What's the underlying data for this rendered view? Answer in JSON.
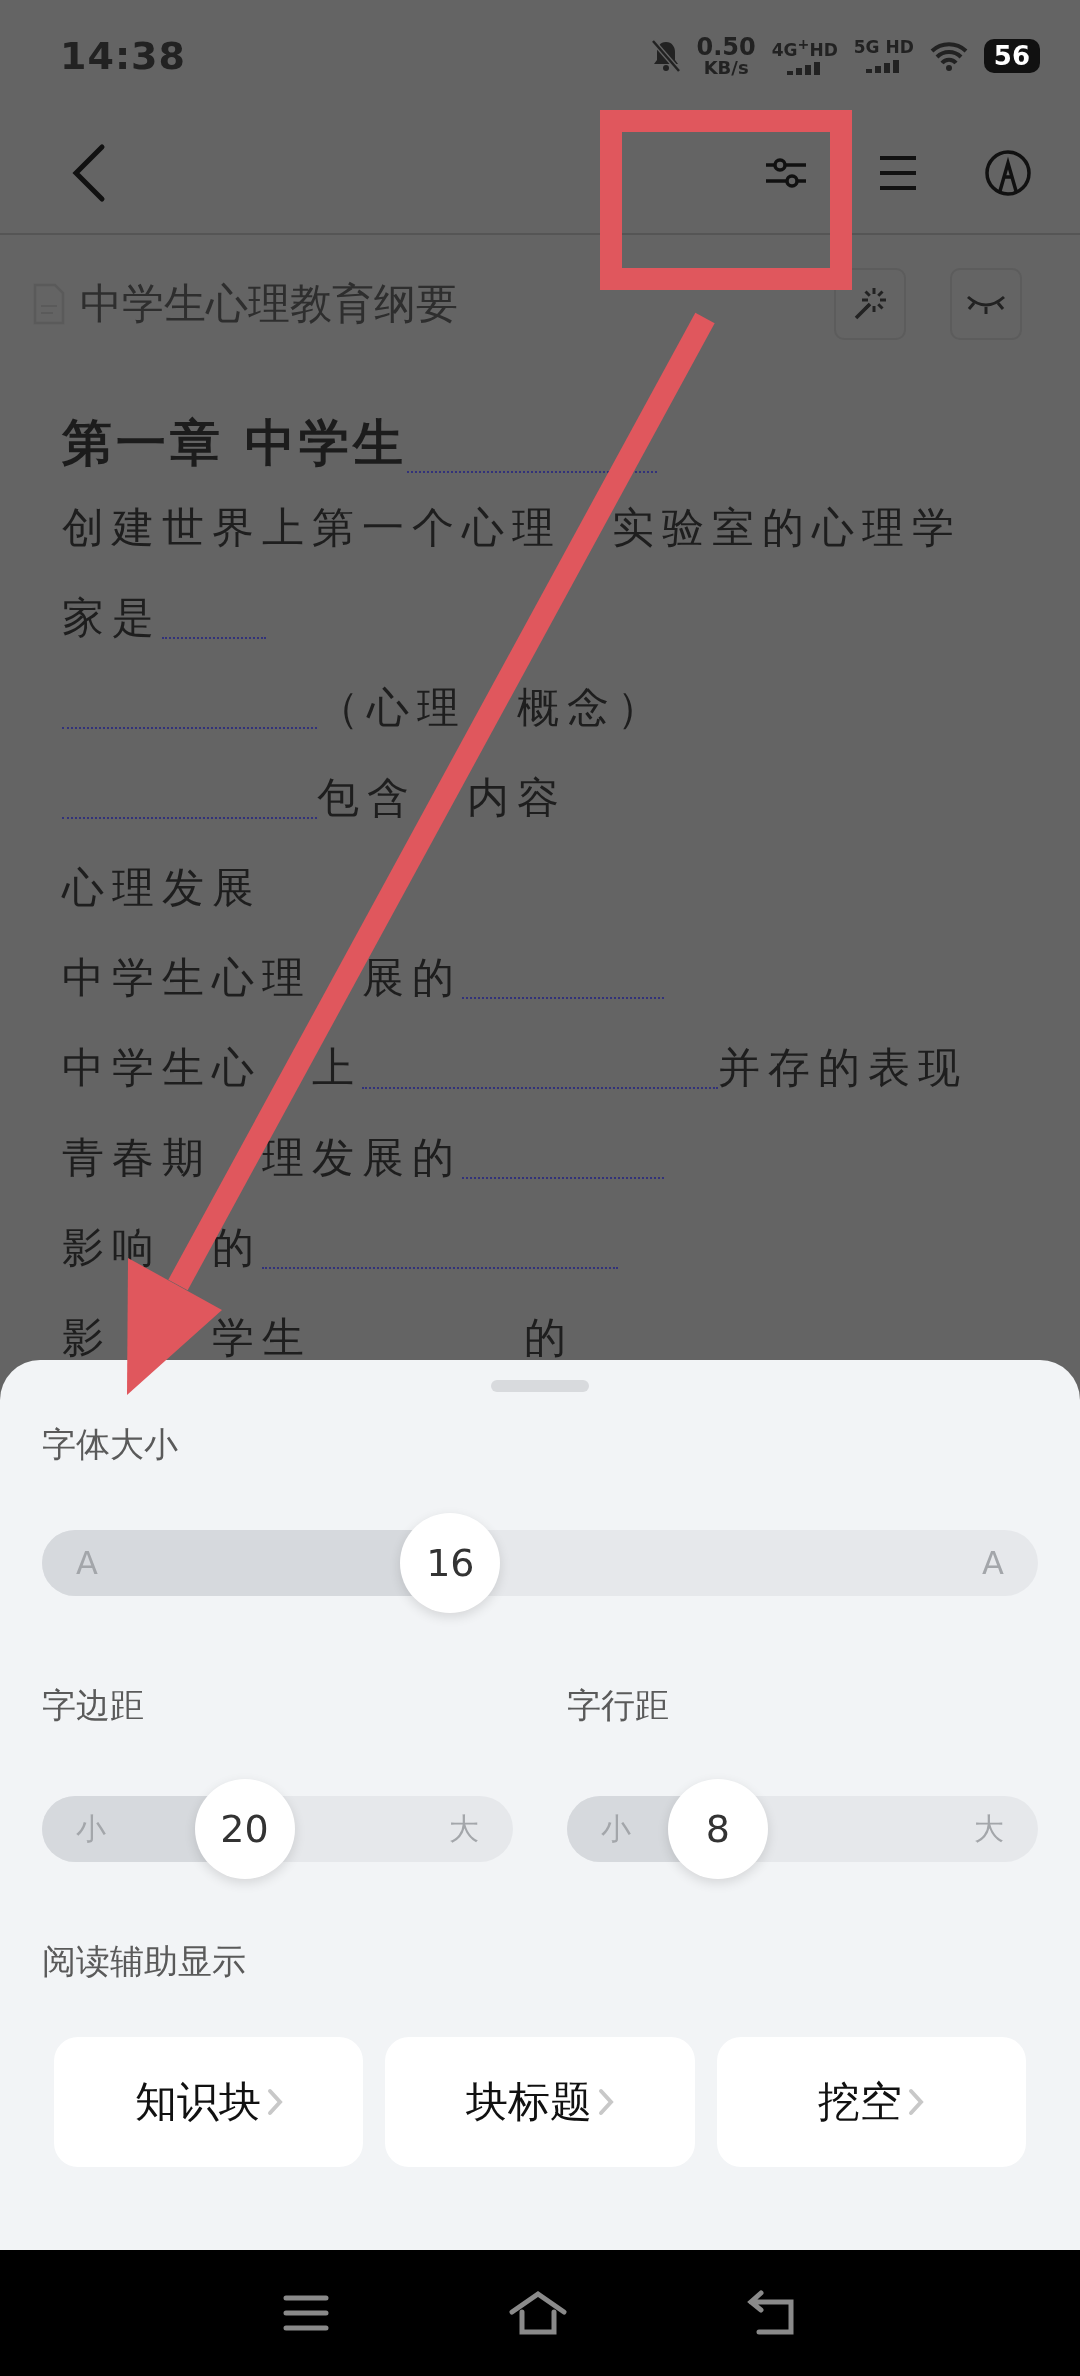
{
  "status_bar": {
    "time": "14:38",
    "net_speed": "0.50",
    "net_unit": "KB/s",
    "sim_1": "4G$^{+}$HD",
    "sim_2": "5G HD",
    "battery": "56"
  },
  "document": {
    "title": "中学生心理教育纲要"
  },
  "content": {
    "heading": [
      {
        "kind": "text",
        "text": "第一章 中学生"
      },
      {
        "kind": "blank"
      }
    ],
    "lines": [
      [
        {
          "kind": "text",
          "text": "创建世界上第一个心理"
        },
        {
          "kind": "hidden"
        },
        {
          "kind": "text",
          "text": "实验室的心理学"
        }
      ],
      [
        {
          "kind": "text",
          "text": "家是"
        },
        {
          "kind": "blank"
        }
      ],
      [
        {
          "kind": "blank"
        },
        {
          "kind": "text",
          "text": "（心理"
        },
        {
          "kind": "hidden"
        },
        {
          "kind": "text",
          "text": "概念）"
        }
      ],
      [
        {
          "kind": "blank"
        },
        {
          "kind": "text",
          "text": "包含"
        },
        {
          "kind": "hidden"
        },
        {
          "kind": "text",
          "text": "内容"
        }
      ],
      [
        {
          "kind": "text",
          "text": "心理发展"
        }
      ],
      [
        {
          "kind": "text",
          "text": "中学生心理"
        },
        {
          "kind": "hidden"
        },
        {
          "kind": "text",
          "text": "展的"
        },
        {
          "kind": "blank"
        }
      ],
      [
        {
          "kind": "text",
          "text": "中学生心"
        },
        {
          "kind": "hidden"
        },
        {
          "kind": "text",
          "text": "上"
        },
        {
          "kind": "blank"
        },
        {
          "kind": "text",
          "text": "并存的表现"
        }
      ],
      [
        {
          "kind": "text",
          "text": "青春期"
        },
        {
          "kind": "hidden"
        },
        {
          "kind": "text",
          "text": "理发展的"
        },
        {
          "kind": "blank"
        }
      ],
      [
        {
          "kind": "text",
          "text": "影响"
        },
        {
          "kind": "hidden"
        },
        {
          "kind": "text",
          "text": "的"
        },
        {
          "kind": "blank"
        }
      ],
      [
        {
          "kind": "text",
          "text": "影"
        },
        {
          "kind": "hidden"
        },
        {
          "kind": "hidden"
        },
        {
          "kind": "text",
          "text": "学生"
        },
        {
          "kind": "space"
        },
        {
          "kind": "text",
          "text": "的"
        }
      ]
    ]
  },
  "settings": {
    "font_size": {
      "label": "字体大小",
      "min_label": "A",
      "max_label": "A",
      "value": "16",
      "level": 0.41
    },
    "margin": {
      "label": "字边距",
      "min_label": "小",
      "max_label": "大",
      "value": "20",
      "level": 0.43
    },
    "line_spacing": {
      "label": "字行距",
      "min_label": "小",
      "max_label": "大",
      "value": "8",
      "level": 0.32
    },
    "reading_aid": {
      "label": "阅读辅助显示",
      "options": [
        {
          "label": "知识块"
        },
        {
          "label": "块标题"
        },
        {
          "label": "挖空"
        }
      ]
    }
  }
}
